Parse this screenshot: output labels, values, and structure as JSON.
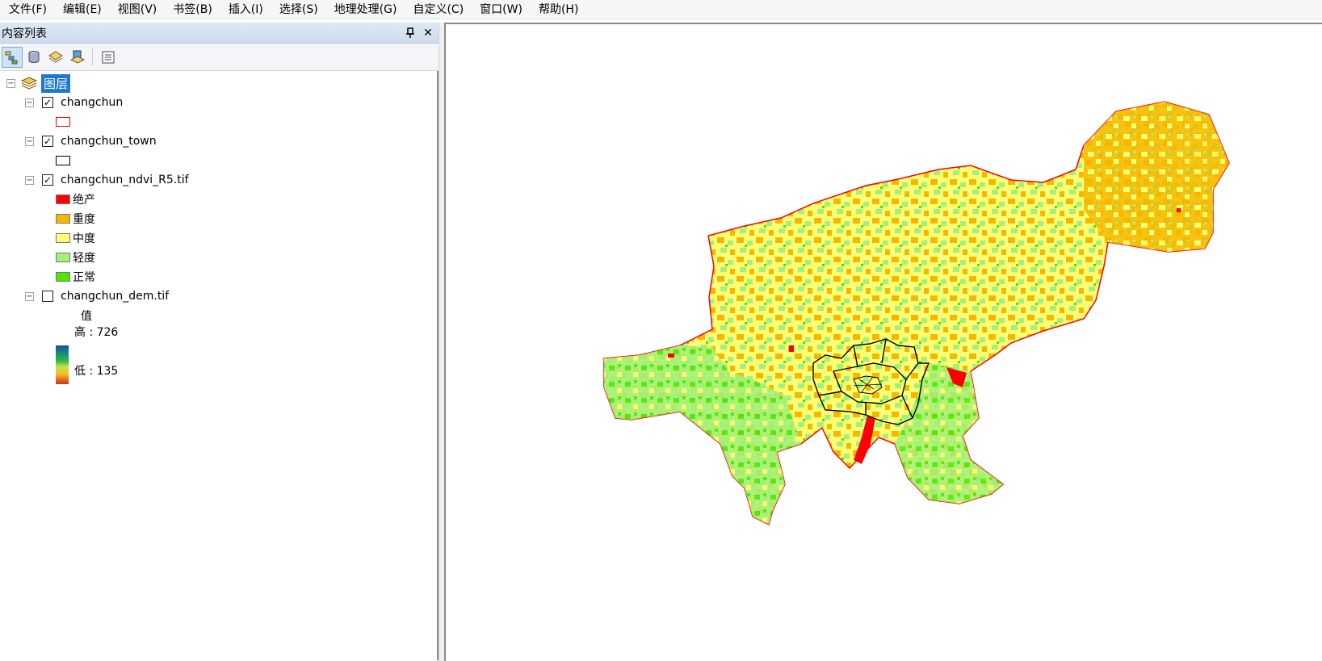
{
  "menu": [
    "文件(F)",
    "编辑(E)",
    "视图(V)",
    "书签(B)",
    "插入(I)",
    "选择(S)",
    "地理处理(G)",
    "自定义(C)",
    "窗口(W)",
    "帮助(H)"
  ],
  "toc": {
    "title": "内容列表",
    "pin_glyph": "ꟷ",
    "close_glyph": "✕",
    "root_label": "图层",
    "layers": [
      {
        "name": "changchun",
        "checked": true
      },
      {
        "name": "changchun_town",
        "checked": true
      },
      {
        "name": "changchun_ndvi_R5.tif",
        "checked": true,
        "classes": [
          {
            "label": "绝产",
            "color": "#ff0000"
          },
          {
            "label": "重度",
            "color": "#f5b800"
          },
          {
            "label": "中度",
            "color": "#ffff73"
          },
          {
            "label": "轻度",
            "color": "#a3f07a"
          },
          {
            "label": "正常",
            "color": "#4ce600"
          }
        ]
      },
      {
        "name": "changchun_dem.tif",
        "checked": false,
        "value_header": "值",
        "high_label": "高 : 726",
        "low_label": "低 : 135"
      }
    ]
  },
  "colors": {
    "boundary": "#ff0000",
    "town": "#000000"
  }
}
